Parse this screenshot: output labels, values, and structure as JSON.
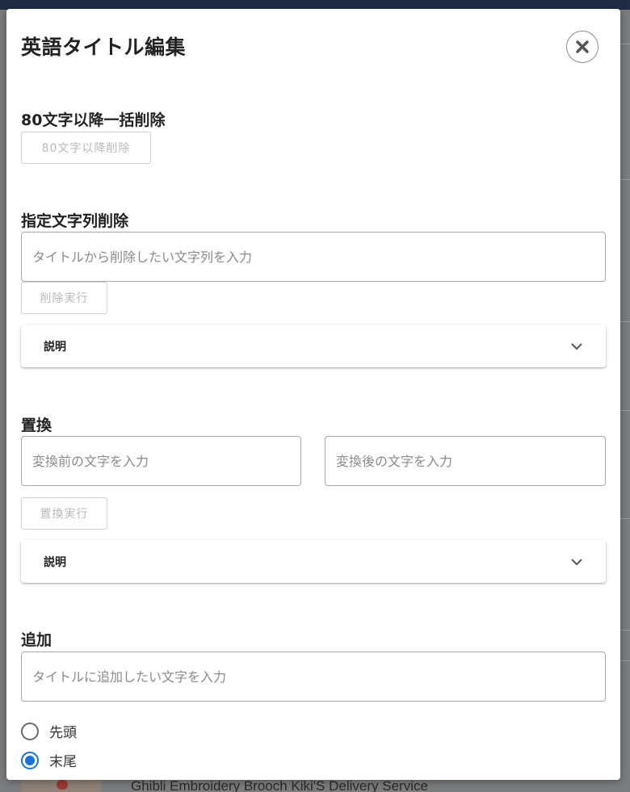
{
  "modal": {
    "title": "英語タイトル編集"
  },
  "bulk_delete": {
    "title": "80文字以降一括削除",
    "button_label": "80文字以降削除"
  },
  "string_delete": {
    "title": "指定文字列削除",
    "input_placeholder": "タイトルから削除したい文字列を入力",
    "input_value": "",
    "button_label": "削除実行",
    "accordion_label": "説明"
  },
  "replace": {
    "title": "置換",
    "before_placeholder": "変換前の文字を入力",
    "after_placeholder": "変換後の文字を入力",
    "button_label": "置換実行",
    "accordion_label": "説明"
  },
  "add": {
    "title": "追加",
    "input_placeholder": "タイトルに追加したい文字を入力",
    "options": [
      {
        "label": "先頭",
        "checked": false
      },
      {
        "label": "末尾",
        "checked": true
      }
    ]
  },
  "background": {
    "product_title": "Ghibli Embroidery Brooch Kiki'S Delivery Service"
  },
  "colors": {
    "accent": "#1a73d9",
    "header_bar": "#1f2c44",
    "overlay": "#7a7c7e"
  },
  "icons": {
    "close": "close-icon",
    "chevron": "chevron-down-icon"
  }
}
